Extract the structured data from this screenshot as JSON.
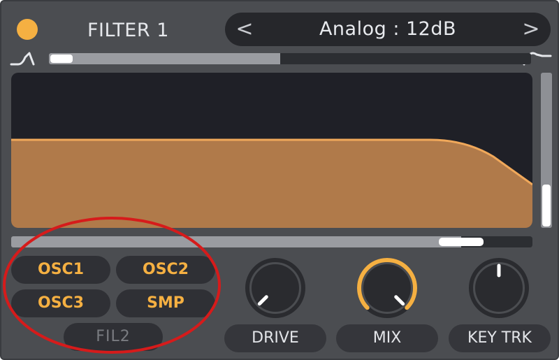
{
  "header": {
    "title": "FILTER 1",
    "power_color": "#f5b042",
    "filter_type": "Analog : 12dB",
    "prev_symbol": "<",
    "next_symbol": ">"
  },
  "filter_icons": {
    "left": "high-pass-icon",
    "right": "low-pass-icon"
  },
  "sliders": {
    "top_fill_fraction": 0.48,
    "top_thumb_fraction": 0.0,
    "right_vertical_fraction": 0.0,
    "bottom_fraction": 0.9
  },
  "routing": {
    "buttons": [
      {
        "label": "OSC1",
        "active": true
      },
      {
        "label": "OSC2",
        "active": true
      },
      {
        "label": "OSC3",
        "active": true
      },
      {
        "label": "SMP",
        "active": true
      },
      {
        "label": "FIL2",
        "active": false
      }
    ]
  },
  "knobs": [
    {
      "label": "DRIVE",
      "value": 0.0,
      "accent": false
    },
    {
      "label": "MIX",
      "value": 1.0,
      "accent": true
    },
    {
      "label": "KEY TRK",
      "value": 0.5,
      "accent": false
    }
  ],
  "colors": {
    "accent": "#f5b042",
    "curve_fill": "#b07a4a",
    "curve_stroke": "#f0a85a",
    "annotation": "#d61b1b"
  }
}
